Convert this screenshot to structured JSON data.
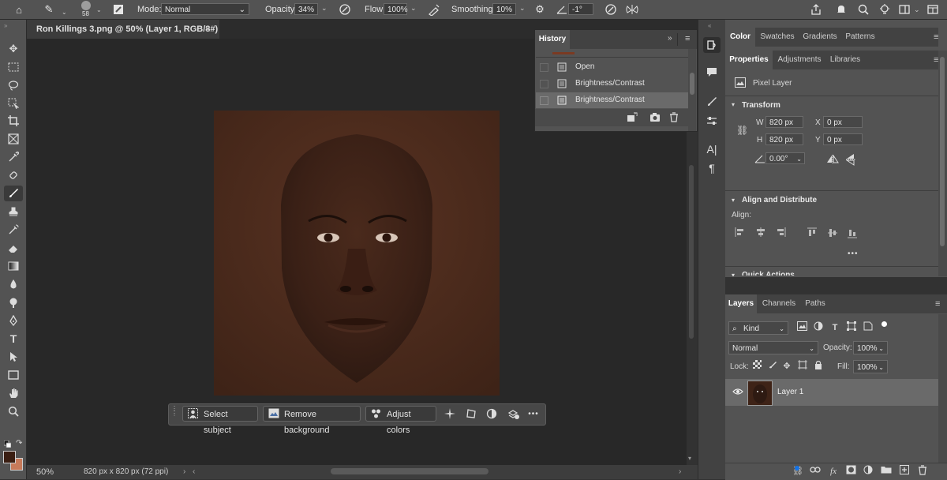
{
  "options_bar": {
    "brush_size": "58",
    "mode_label": "Mode:",
    "mode_value": "Normal",
    "opacity_label": "Opacity:",
    "opacity_value": "34%",
    "flow_label": "Flow:",
    "flow_value": "100%",
    "smoothing_label": "Smoothing:",
    "smoothing_value": "10%",
    "angle_value": "-1°"
  },
  "document": {
    "tab_title": "Ron Killings 3.png @ 50% (Layer 1, RGB/8#) *",
    "close_glyph": "×",
    "zoom": "50%",
    "dimensions": "820 px x 820 px (72 ppi)"
  },
  "contextual_bar": {
    "select_subject": "Select subject",
    "remove_background": "Remove background",
    "adjust_colors": "Adjust colors",
    "more": "•••"
  },
  "history": {
    "title": "History",
    "items": [
      "Open",
      "Brightness/Contrast",
      "Brightness/Contrast"
    ]
  },
  "top_tabs": [
    "Color",
    "Swatches",
    "Gradients",
    "Patterns"
  ],
  "properties": {
    "tabs": [
      "Properties",
      "Adjustments",
      "Libraries"
    ],
    "layer_type": "Pixel Layer",
    "transform_title": "Transform",
    "w_label": "W",
    "w_value": "820 px",
    "h_label": "H",
    "h_value": "820 px",
    "x_label": "X",
    "x_value": "0 px",
    "y_label": "Y",
    "y_value": "0 px",
    "angle_value": "0.00°",
    "align_title": "Align and Distribute",
    "align_label": "Align:",
    "more": "•••",
    "quick_actions": "Quick Actions"
  },
  "layers": {
    "tabs": [
      "Layers",
      "Channels",
      "Paths"
    ],
    "filter_kind": "Kind",
    "blend_mode": "Normal",
    "opacity_label": "Opacity:",
    "opacity_value": "100%",
    "lock_label": "Lock:",
    "fill_label": "Fill:",
    "fill_value": "100%",
    "layer_name": "Layer 1"
  },
  "colors": {
    "foreground": "#3a1e12",
    "background": "#c77a5a",
    "accent": "#1473e6"
  }
}
